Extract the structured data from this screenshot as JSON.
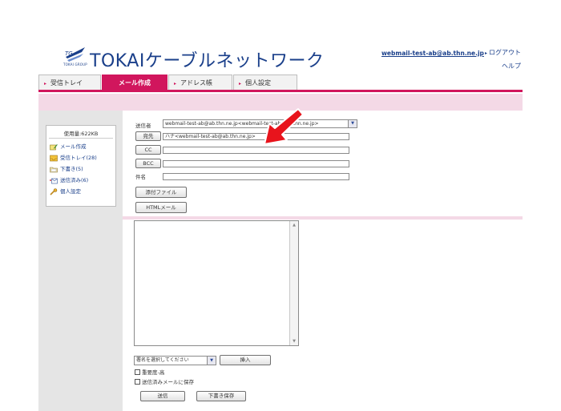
{
  "header": {
    "logo_sub": "TOKAI GROUP",
    "logo_text": "TOKAIケーブルネットワーク",
    "user_email": "webmail-test-ab@ab.thn.ne.jp",
    "logout_label": "ログアウト",
    "help_label": "ヘルプ"
  },
  "tabs": [
    {
      "label": "受信トレイ"
    },
    {
      "label": "メール作成"
    },
    {
      "label": "アドレス帳"
    },
    {
      "label": "個人設定"
    }
  ],
  "sidebar": {
    "usage": "使用量:622KB",
    "items": [
      {
        "label": "メール作成",
        "icon": "compose-icon"
      },
      {
        "label": "受信トレイ(28)",
        "icon": "inbox-icon"
      },
      {
        "label": "下書き(5)",
        "icon": "drafts-icon"
      },
      {
        "label": "送信済み(6)",
        "icon": "sent-icon"
      },
      {
        "label": "個人設定",
        "icon": "settings-icon"
      }
    ]
  },
  "compose": {
    "from_label": "送信者",
    "from_value": "webmail-test-ab@ab.thn.ne.jp<webmail-test-ab@ab.thn.ne.jp>",
    "to_button": "宛先",
    "to_value": "ハナ<webmail-test-ab@ab.thn.ne.jp>",
    "cc_button": "CC",
    "cc_value": "",
    "bcc_button": "BCC",
    "bcc_value": "",
    "subject_label": "件名",
    "subject_value": "",
    "attach_button": "添付ファイル",
    "html_button": "HTMLメール",
    "body_value": "",
    "signature_select": "署名を選択してください",
    "insert_button": "挿入",
    "priority_label": "重要度-高",
    "save_sent_label": "送信済みメールに保存",
    "send_button": "送信",
    "save_draft_button": "下書き保存"
  },
  "colors": {
    "accent": "#d1165d",
    "accent_light": "#f4d9e6",
    "brand": "#1a3f8a",
    "sidebar_bg": "#e5e5e5",
    "annotation_arrow": "#e8141c"
  }
}
